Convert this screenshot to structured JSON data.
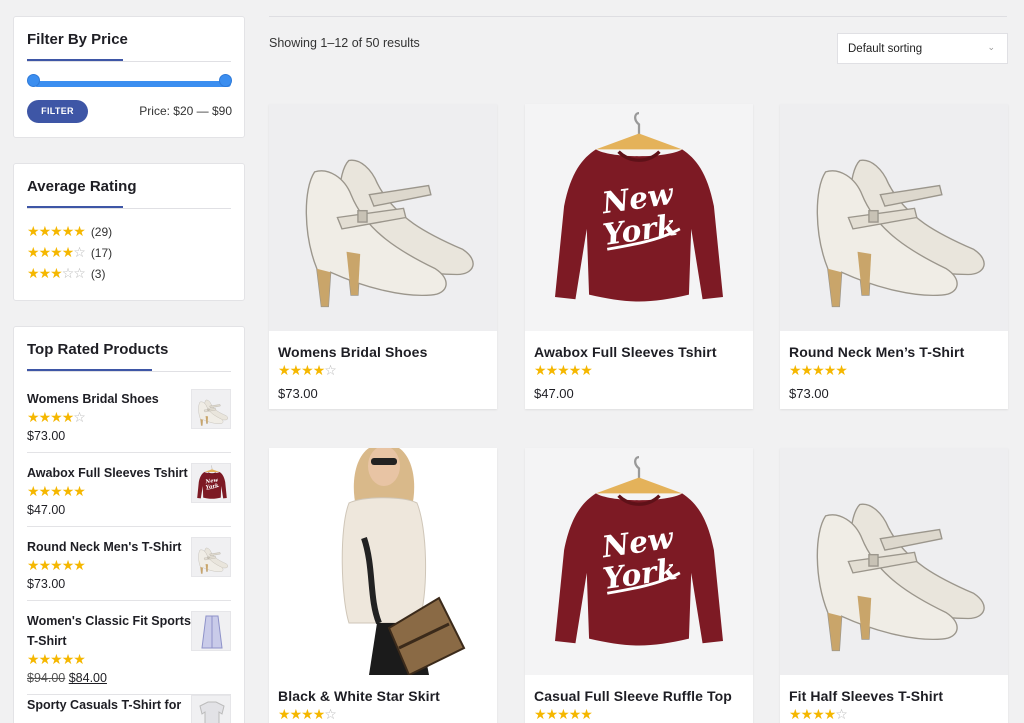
{
  "filter_price": {
    "title": "Filter By Price",
    "button_label": "FILTER",
    "price_label": "Price: $20 — $90"
  },
  "average_rating": {
    "title": "Average Rating",
    "rows": [
      {
        "stars": 5,
        "count": "(29)"
      },
      {
        "stars": 4,
        "count": "(17)"
      },
      {
        "stars": 3,
        "count": "(3)"
      }
    ]
  },
  "top_rated": {
    "title": "Top Rated Products",
    "items": [
      {
        "name": "Womens Bridal Shoes",
        "stars": 4,
        "price": "$73.00",
        "thumb": "shoes"
      },
      {
        "name": "Awabox Full Sleeves Tshirt",
        "stars": 5,
        "price": "$47.00",
        "thumb": "sweater"
      },
      {
        "name": "Round Neck Men's T-Shirt",
        "stars": 5,
        "price": "$73.00",
        "thumb": "shoes"
      },
      {
        "name": "Women's Classic Fit Sports T-Shirt",
        "stars": 5,
        "old_price": "$94.00",
        "price": "$84.00",
        "thumb": "dress"
      },
      {
        "name": "Sporty Casuals T-Shirt for",
        "stars": 0,
        "price": "",
        "thumb": "shirt"
      }
    ]
  },
  "toolbar": {
    "results_text": "Showing 1–12 of 50 results",
    "sorting_value": "Default sorting"
  },
  "products": [
    {
      "name": "Womens Bridal Shoes",
      "stars": 4,
      "price": "$73.00",
      "image": "shoes"
    },
    {
      "name": "Awabox Full Sleeves Tshirt",
      "stars": 5,
      "price": "$47.00",
      "image": "sweater"
    },
    {
      "name": "Round Neck Men’s T-Shirt",
      "stars": 5,
      "price": "$73.00",
      "image": "shoes"
    },
    {
      "name": "Black & White Star Skirt",
      "stars": 4,
      "price": "",
      "image": "woman"
    },
    {
      "name": "Casual Full Sleeve Ruffle Top",
      "stars": 5,
      "price": "",
      "image": "sweater"
    },
    {
      "name": "Fit Half Sleeves T-Shirt",
      "stars": 4,
      "price": "",
      "image": "shoes"
    }
  ],
  "sweater_print": {
    "line1": "New",
    "line2": "York"
  },
  "colors": {
    "accent": "#3e56a6",
    "slider": "#3b8ef0",
    "star": "#f5b700",
    "sweater": "#7d1a24"
  }
}
